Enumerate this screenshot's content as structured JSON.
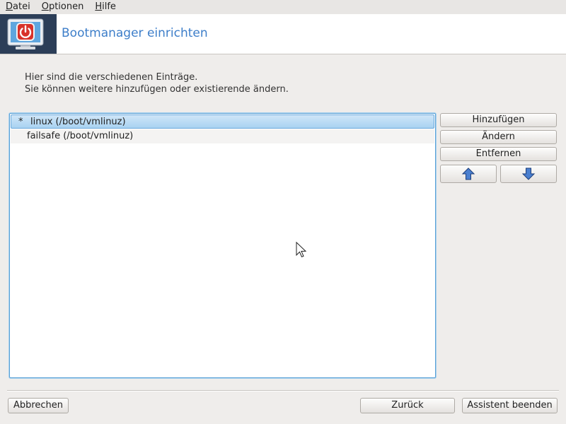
{
  "menu": {
    "items": [
      {
        "mnemonic": "D",
        "rest": "atei"
      },
      {
        "mnemonic": "O",
        "rest": "ptionen"
      },
      {
        "mnemonic": "H",
        "rest": "ilfe"
      }
    ]
  },
  "header": {
    "title": "Bootmanager einrichten",
    "icon": "power-monitor-icon"
  },
  "instructions": {
    "line1": "Hier sind die verschiedenen Einträge.",
    "line2": "Sie können weitere hinzufügen oder existierende ändern."
  },
  "entries": [
    {
      "default_marker": "*",
      "label": "linux (/boot/vmlinuz)",
      "selected": true
    },
    {
      "default_marker": "",
      "label": "failsafe (/boot/vmlinuz)",
      "selected": false
    }
  ],
  "actions": {
    "add": "Hinzufügen",
    "modify": "Ändern",
    "remove": "Entfernen",
    "up_icon": "arrow-up-icon",
    "down_icon": "arrow-down-icon"
  },
  "footer": {
    "cancel": "Abbrechen",
    "back": "Zurück",
    "finish": "Assistent beenden"
  },
  "colors": {
    "accent_title": "#3d7ec9",
    "selection": "#a9d2f1",
    "arrow_blue": "#3f74c4",
    "banner_icon_bg": "#2c3e58",
    "power_red": "#d8322a"
  }
}
